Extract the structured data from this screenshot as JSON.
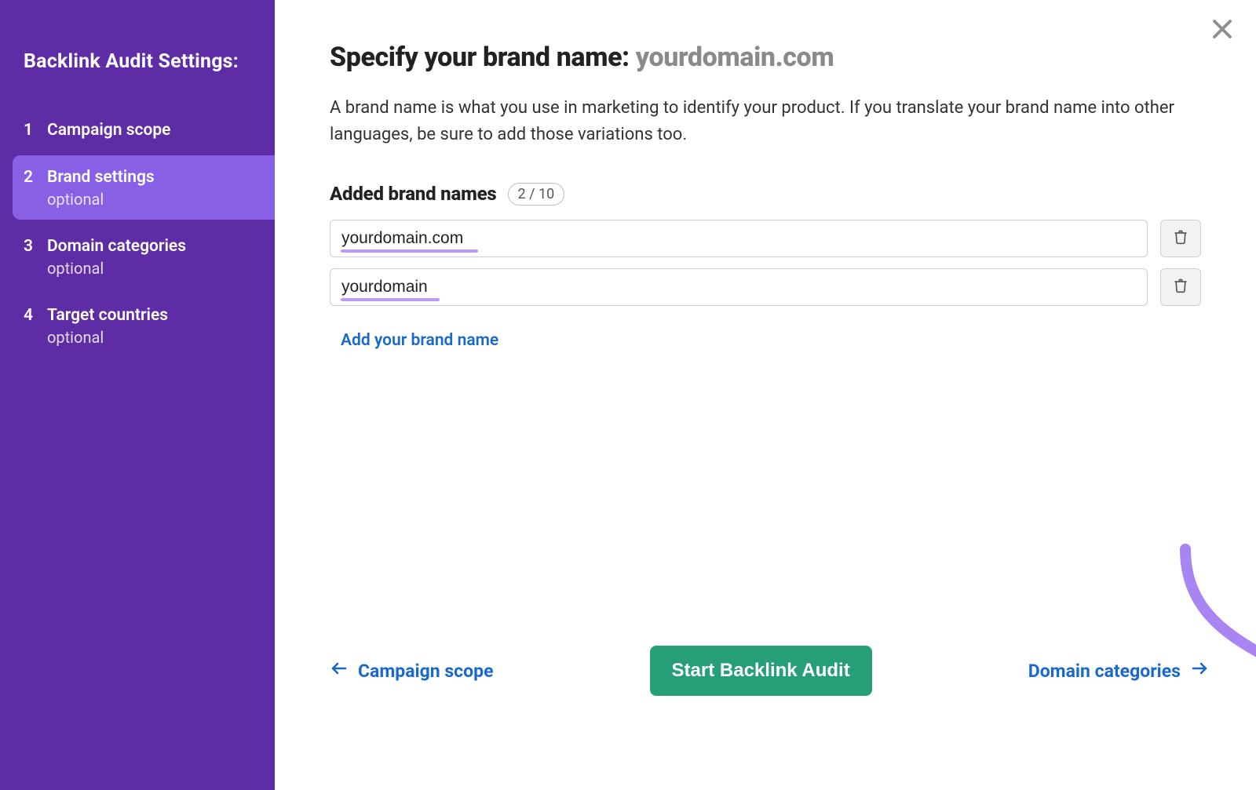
{
  "sidebar": {
    "title": "Backlink Audit Settings:",
    "steps": [
      {
        "num": "1",
        "label": "Campaign scope",
        "sub": ""
      },
      {
        "num": "2",
        "label": "Brand settings",
        "sub": "optional"
      },
      {
        "num": "3",
        "label": "Domain categories",
        "sub": "optional"
      },
      {
        "num": "4",
        "label": "Target countries",
        "sub": "optional"
      }
    ]
  },
  "main": {
    "heading_prefix": "Specify your brand name: ",
    "heading_domain": "yourdomain.com",
    "intro": "A brand name is what you use in marketing to identify your product. If you translate your brand name into other languages, be sure to add those variations too.",
    "subhead": "Added brand names",
    "pill": "2 / 10",
    "brands": [
      "yourdomain.com",
      "yourdomain"
    ],
    "underline_widths": [
      "175px",
      "126px"
    ],
    "add_link": "Add your brand name"
  },
  "footer": {
    "prev": "Campaign scope",
    "cta": "Start Backlink Audit",
    "next": "Domain categories"
  },
  "colors": {
    "sidebar_bg": "#5E2CA5",
    "active_bg": "#8860E6",
    "link_blue": "#1967d2",
    "cta_green": "#269f79",
    "accent_violet": "#b99df0"
  }
}
